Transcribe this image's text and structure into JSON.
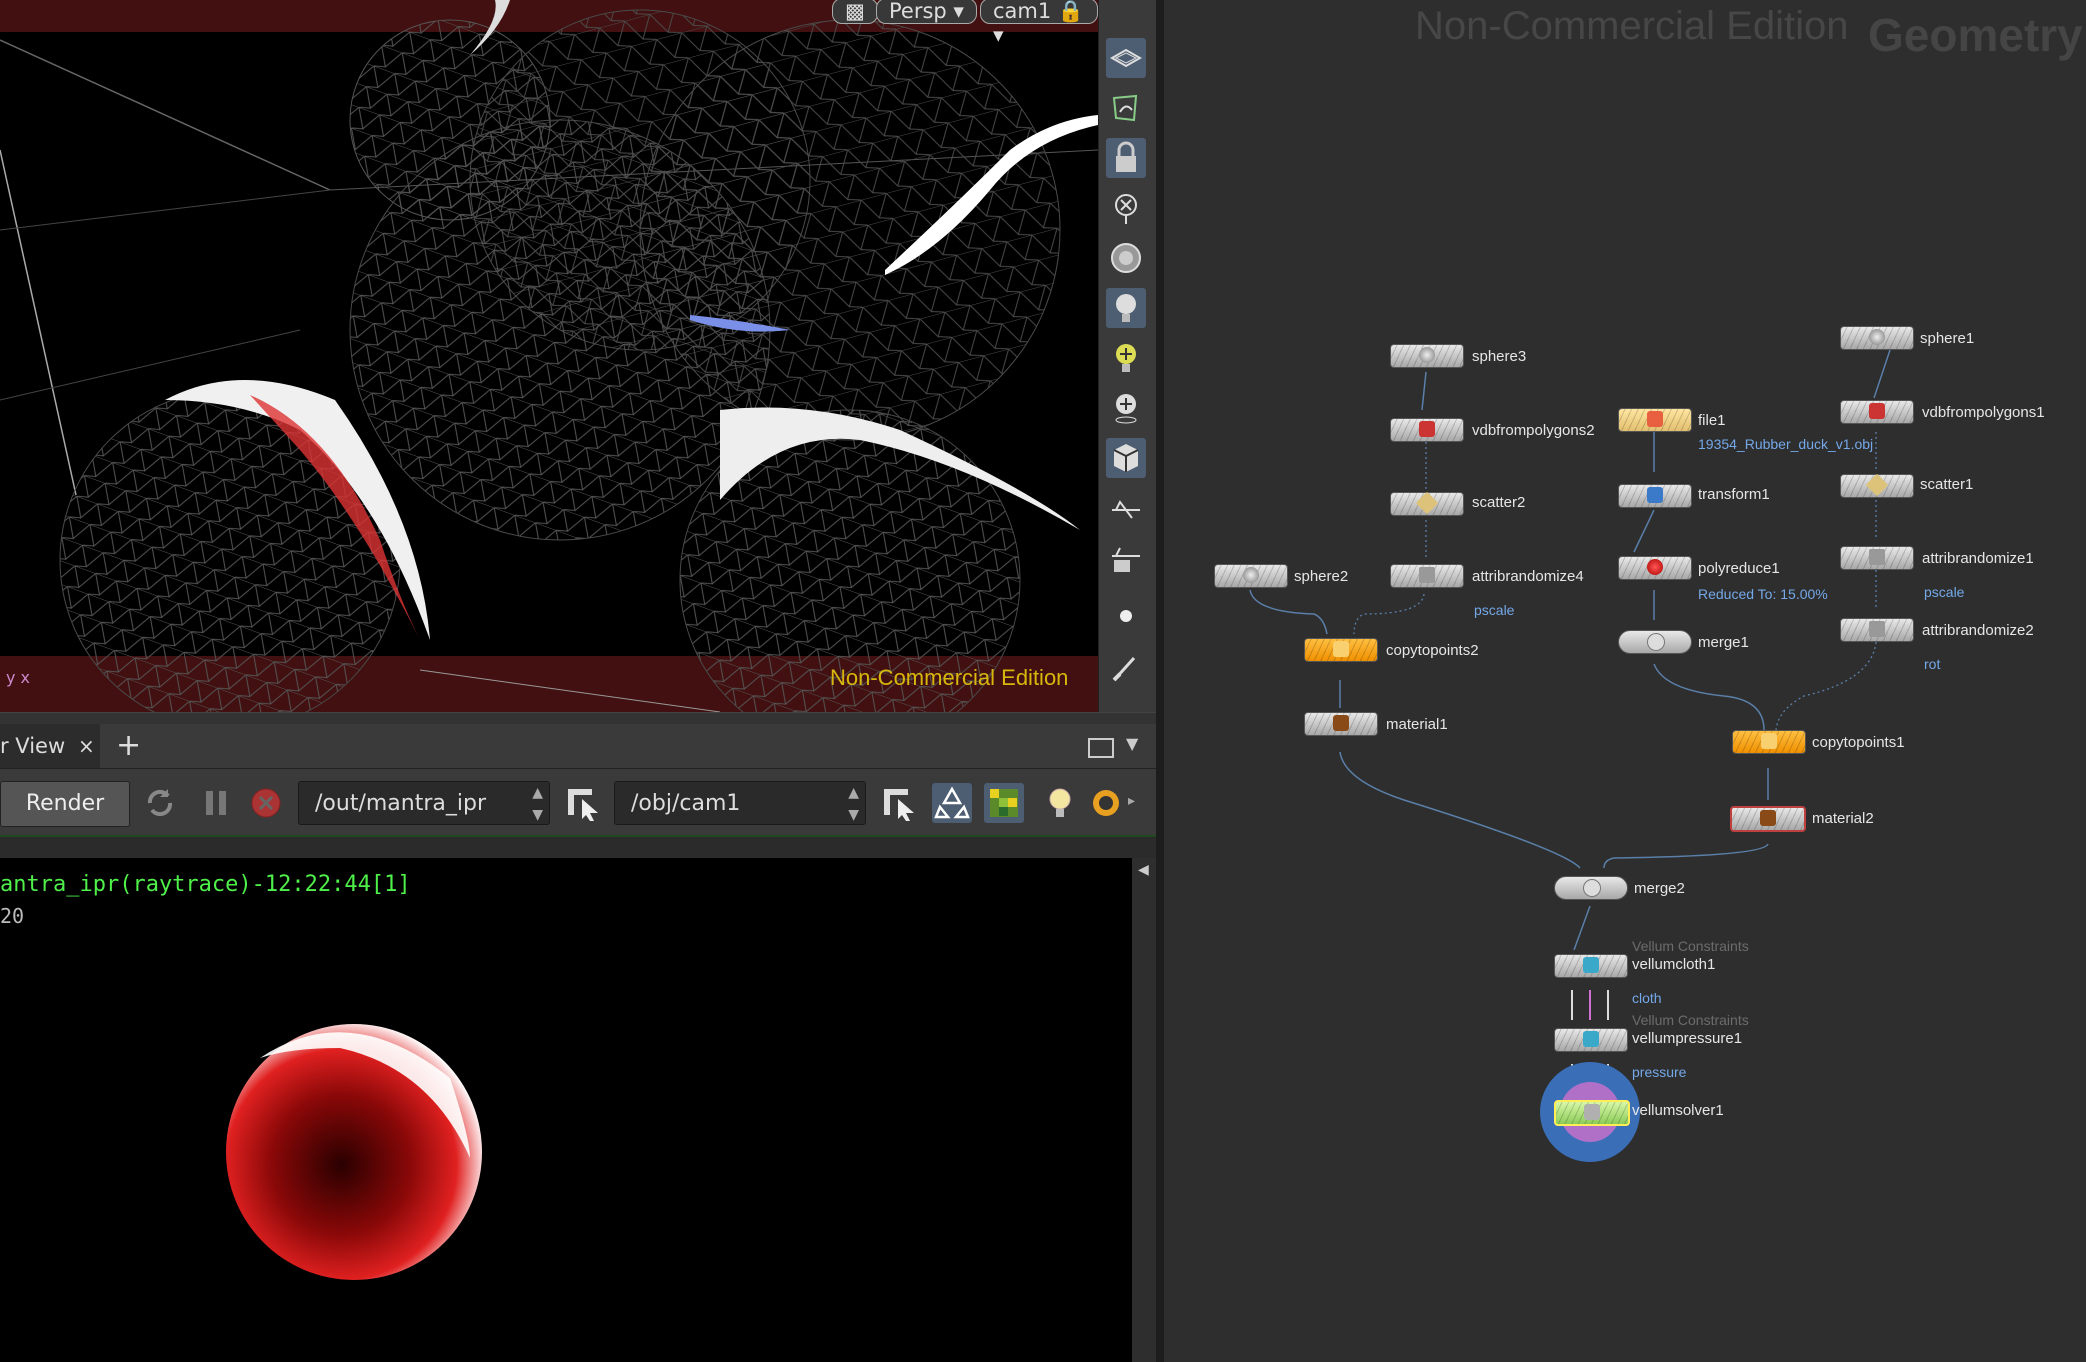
{
  "viewport": {
    "view_menu": "Persp",
    "camera_menu": "cam1",
    "watermark": "Non-Commercial Edition",
    "axis_label": "y x"
  },
  "viewport_tools": [
    "display-options-icon",
    "snap-icon",
    "lock-camera-icon",
    "hide-icon",
    "headlight-icon",
    "light-icon",
    "add-light-icon",
    "add-light-2-icon",
    "object-display-icon",
    "ghost-icon",
    "ghost-2-icon",
    "point-icon",
    "brush-icon"
  ],
  "render_view": {
    "tab_label": "r View",
    "tab_close": "×",
    "add_tab": "+",
    "render_button": "Render",
    "rop_path": "/out/mantra_ipr",
    "camera_path": "/obj/cam1",
    "status_line": "antra_ipr(raytrace)-12:22:44[1]",
    "frame_line": "20"
  },
  "network": {
    "watermark": "Non-Commercial Edition",
    "context": "Geometry",
    "nodes": [
      {
        "id": "sphere3",
        "label": "sphere3"
      },
      {
        "id": "vdbfrompolygons2",
        "label": "vdbfrompolygons2"
      },
      {
        "id": "scatter2",
        "label": "scatter2"
      },
      {
        "id": "attribrandomize4",
        "label": "attribrandomize4",
        "sub": "pscale"
      },
      {
        "id": "sphere2",
        "label": "sphere2"
      },
      {
        "id": "copytopoints2",
        "label": "copytopoints2"
      },
      {
        "id": "material1",
        "label": "material1"
      },
      {
        "id": "file1",
        "label": "file1",
        "sub": "19354_Rubber_duck_v1.obj"
      },
      {
        "id": "transform1",
        "label": "transform1"
      },
      {
        "id": "polyreduce1",
        "label": "polyreduce1",
        "sub": "Reduced To: 15.00%"
      },
      {
        "id": "merge1",
        "label": "merge1"
      },
      {
        "id": "sphere1",
        "label": "sphere1"
      },
      {
        "id": "vdbfrompolygons1",
        "label": "vdbfrompolygons1"
      },
      {
        "id": "scatter1",
        "label": "scatter1"
      },
      {
        "id": "attribrandomize1",
        "label": "attribrandomize1",
        "sub": "pscale"
      },
      {
        "id": "attribrandomize2",
        "label": "attribrandomize2",
        "sub": "rot"
      },
      {
        "id": "copytopoints1",
        "label": "copytopoints1"
      },
      {
        "id": "material2",
        "label": "material2"
      },
      {
        "id": "merge2",
        "label": "merge2"
      },
      {
        "id": "vellumcloth1",
        "label": "vellumcloth1",
        "group": "Vellum Constraints",
        "sub": "cloth"
      },
      {
        "id": "vellumpressure1",
        "label": "vellumpressure1",
        "group": "Vellum Constraints",
        "sub": "pressure"
      },
      {
        "id": "vellumsolver1",
        "label": "vellumsolver1"
      }
    ]
  },
  "colors": {
    "ipr_status": "#4ff04a",
    "watermark": "#d8b70b",
    "link_blue": "#74a8e8",
    "orange_node": "#f7a21b",
    "solver_ring": "#3a6fb8"
  }
}
